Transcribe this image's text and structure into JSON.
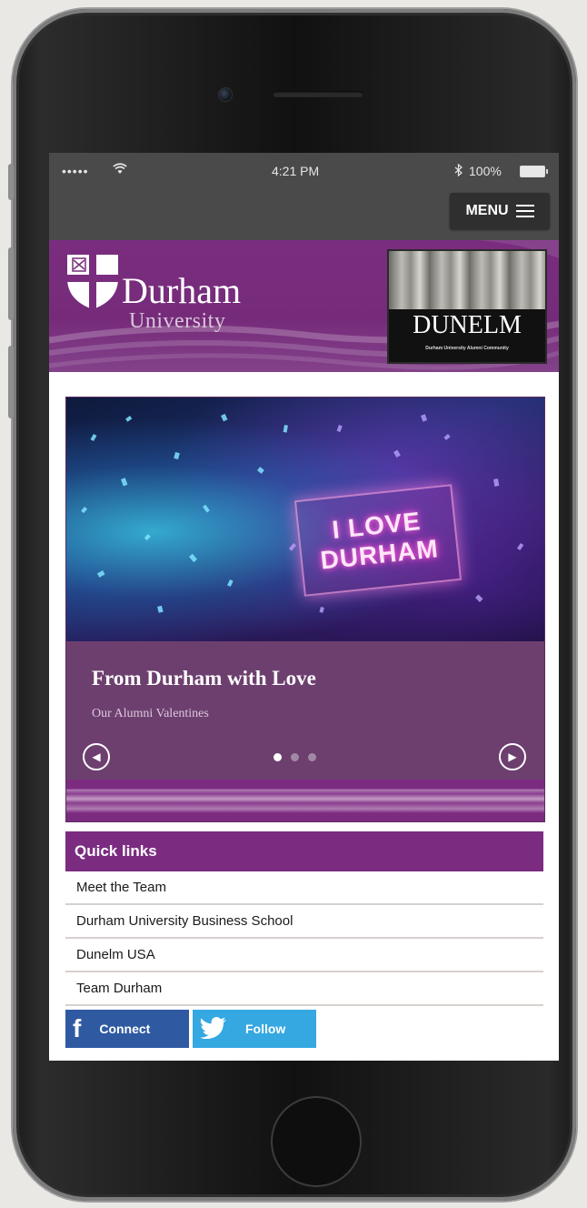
{
  "status_bar": {
    "signal": "•••••",
    "time": "4:21 PM",
    "battery": "100%"
  },
  "nav": {
    "menu_label": "MENU"
  },
  "header": {
    "logo_line1": "Durham",
    "logo_line2": "University",
    "partner_title": "DUNELM",
    "partner_subtitle": "Durham University Alumni Community"
  },
  "carousel": {
    "image_text": [
      "I LOVE",
      "DURHAM"
    ],
    "slide_title": "From Durham with Love",
    "slide_subtitle": "Our Alumni Valentines",
    "slide_count": 3,
    "active_slide": 1
  },
  "quick_links": {
    "title": "Quick links",
    "items": [
      "Meet the Team",
      "Durham University Business School",
      "Dunelm USA",
      "Team Durham"
    ]
  },
  "social": {
    "facebook_label": "Connect",
    "twitter_label": "Follow"
  },
  "colors": {
    "brand_purple": "#7b2c80",
    "status_bar": "#4a4a4a",
    "facebook": "#2f5aa2",
    "twitter": "#35a8e2"
  }
}
